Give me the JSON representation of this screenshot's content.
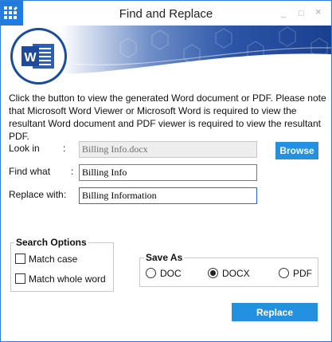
{
  "window": {
    "title": "Find and Replace",
    "minimize": "_",
    "maximize": "□",
    "close": "×"
  },
  "info_text": "Click the button to view the generated Word document or PDF. Please note that Microsoft Word Viewer or Microsoft Word is required to view the resultant Word document and PDF viewer is required to view the resultant PDF.",
  "form": {
    "look_in": {
      "label": "Look in",
      "colon": ":",
      "value": "Billing Info.docx"
    },
    "find_what": {
      "label": "Find what",
      "colon": ":",
      "value": "Billing Info"
    },
    "replace_with": {
      "label": "Replace with",
      "colon": ":",
      "value": "Billing Information"
    }
  },
  "browse_label": "Browse",
  "search_options": {
    "title": "Search Options",
    "match_case": "Match case",
    "match_whole_word": "Match whole word"
  },
  "save_as": {
    "title": "Save As",
    "options": [
      "DOC",
      "DOCX",
      "PDF"
    ],
    "selected": "DOCX"
  },
  "replace_label": "Replace",
  "colors": {
    "accent": "#2390e0",
    "banner_dark": "#1a3f8f"
  }
}
